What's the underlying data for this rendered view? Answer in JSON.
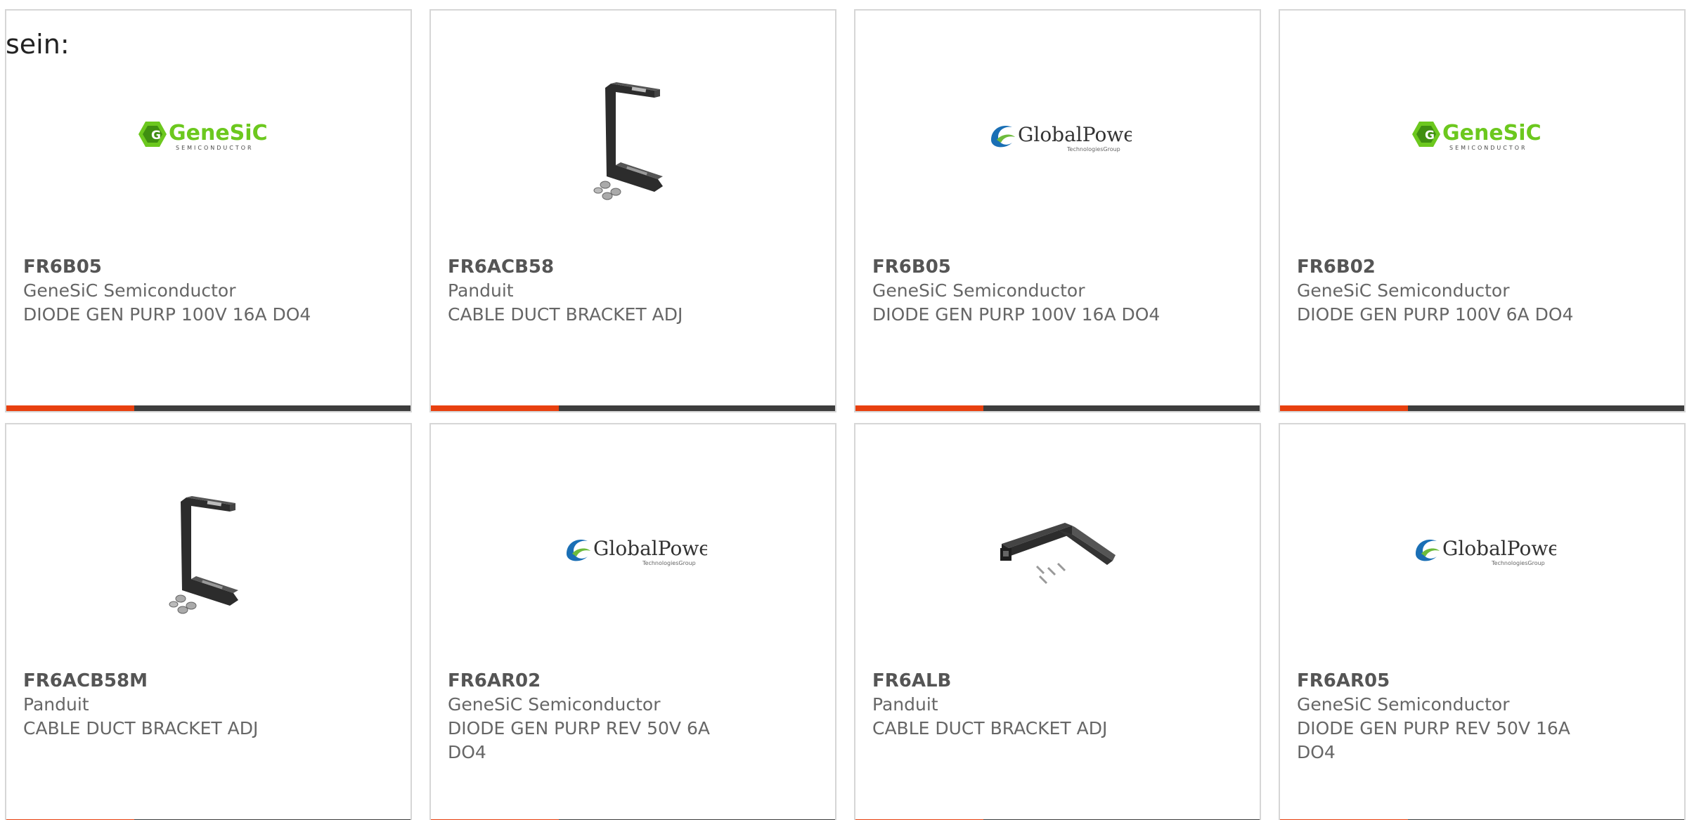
{
  "intro_text": "sein:",
  "brand_colors": {
    "accent": "#e8400f",
    "bar": "#3d3d3d",
    "genesic_green": "#6cc81e",
    "globalpower_blue": "#1a6fb5"
  },
  "products": [
    {
      "part": "FR6B05",
      "manufacturer": "GeneSiC Semiconductor",
      "description": "DIODE GEN PURP 100V 16A DO4",
      "image": "genesic-logo"
    },
    {
      "part": "FR6ACB58",
      "manufacturer": "Panduit",
      "description": "CABLE DUCT BRACKET ADJ",
      "image": "c-bracket"
    },
    {
      "part": "FR6B05",
      "manufacturer": "GeneSiC Semiconductor",
      "description": "DIODE GEN PURP 100V 16A DO4",
      "image": "globalpower-logo"
    },
    {
      "part": "FR6B02",
      "manufacturer": "GeneSiC Semiconductor",
      "description": "DIODE GEN PURP 100V 6A DO4",
      "image": "genesic-logo"
    },
    {
      "part": "FR6ACB58M",
      "manufacturer": "Panduit",
      "description": "CABLE DUCT BRACKET ADJ",
      "image": "c-bracket"
    },
    {
      "part": "FR6AR02",
      "manufacturer": "GeneSiC Semiconductor",
      "description": "DIODE GEN PURP REV 50V 6A DO4",
      "image": "globalpower-logo"
    },
    {
      "part": "FR6ALB",
      "manufacturer": "Panduit",
      "description": "CABLE DUCT BRACKET ADJ",
      "image": "l-bracket"
    },
    {
      "part": "FR6AR05",
      "manufacturer": "GeneSiC Semiconductor",
      "description": "DIODE GEN PURP REV 50V 16A DO4",
      "image": "globalpower-logo"
    }
  ],
  "logos": {
    "genesic_main": "GeneSiC",
    "genesic_sub": "SEMICONDUCTOR",
    "globalpower_main": "GlobalPower",
    "globalpower_sub": "TechnologiesGroup"
  }
}
